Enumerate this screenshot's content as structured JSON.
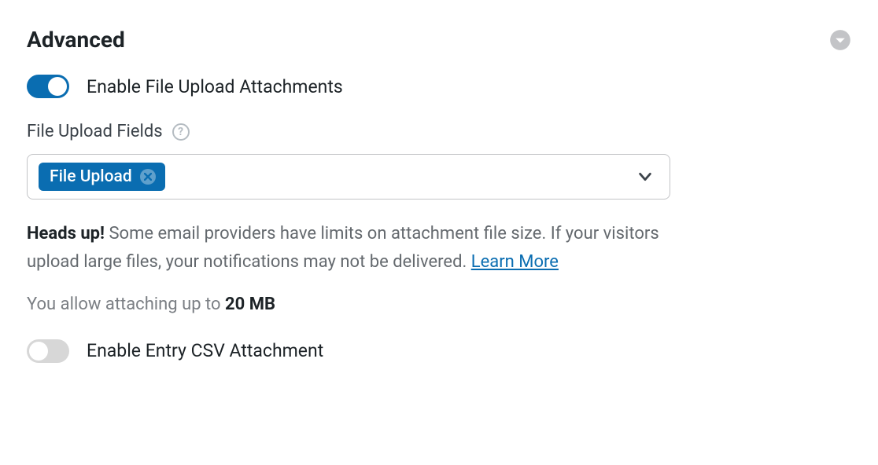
{
  "section": {
    "title": "Advanced"
  },
  "toggles": {
    "file_upload_attachments": {
      "label": "Enable File Upload Attachments",
      "value": true
    },
    "entry_csv_attachment": {
      "label": "Enable Entry CSV Attachment",
      "value": false
    }
  },
  "file_upload_fields": {
    "label": "File Upload Fields",
    "selected_chips": [
      "File Upload"
    ]
  },
  "notice": {
    "bold_lead": "Heads up!",
    "body_part1": " Some email providers have limits on attachment file size. If your visitors upload large files, your notifications may not be delivered. ",
    "learn_more": "Learn More"
  },
  "limit": {
    "prefix": "You allow attaching up to ",
    "size": "20 MB"
  }
}
